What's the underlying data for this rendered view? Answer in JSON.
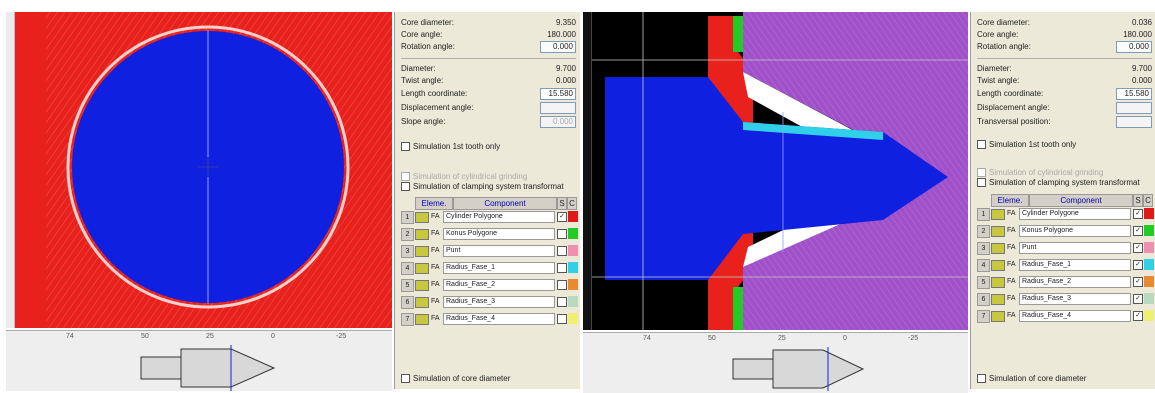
{
  "left_panel": {
    "params": [
      {
        "label": "Core diameter:",
        "value": "9.350"
      },
      {
        "label": "Core angle:",
        "value": "180.000"
      },
      {
        "label": "Rotation angle:",
        "value": "0.000",
        "input": true
      }
    ],
    "params2": [
      {
        "label": "Diameter:",
        "value": "9.700"
      },
      {
        "label": "Twist angle:",
        "value": "0.000"
      },
      {
        "label": "Length coordinate:",
        "value": "15.580",
        "input": true
      },
      {
        "label": "Displacement angle:",
        "value": "",
        "input": true,
        "disabled": true
      },
      {
        "label": "Slope angle:",
        "value": "0.000",
        "input": true,
        "disabled": true
      }
    ],
    "sim_first_tooth": "Simulation 1st tooth only",
    "sim_cylindrical": "Simulation of cylindrical grinding",
    "sim_clamping": "Simulation of clamping system transformat",
    "sim_core": "Simulation of core diameter",
    "grid": {
      "head_elem": "Eleme.",
      "head_comp": "Component",
      "head_s": "S",
      "head_c": "C",
      "rows": [
        {
          "num": "1",
          "fa": "FA",
          "name": "Cylinder Polygone",
          "checked": true,
          "color": "#e01818"
        },
        {
          "num": "2",
          "fa": "FA",
          "name": "Konus Polygone",
          "checked": false,
          "color": "#22cc22"
        },
        {
          "num": "3",
          "fa": "FA",
          "name": "Punt",
          "checked": false,
          "color": "#f090b0"
        },
        {
          "num": "4",
          "fa": "FA",
          "name": "Radius_Fase_1",
          "checked": false,
          "color": "#30d0e8"
        },
        {
          "num": "5",
          "fa": "FA",
          "name": "Radius_Fase_2",
          "checked": false,
          "color": "#e88a30"
        },
        {
          "num": "6",
          "fa": "FA",
          "name": "Radius_Fase_3",
          "checked": false,
          "color": "#b8d8c0"
        },
        {
          "num": "7",
          "fa": "FA",
          "name": "Radius_Fase_4",
          "checked": false,
          "color": "#f0f070"
        }
      ]
    },
    "x_ticks": [
      "74",
      "50",
      "25",
      "0",
      "-25"
    ]
  },
  "right_panel": {
    "params": [
      {
        "label": "Core diameter:",
        "value": "0.036"
      },
      {
        "label": "Core angle:",
        "value": "180.000"
      },
      {
        "label": "Rotation angle:",
        "value": "0.000",
        "input": true
      }
    ],
    "params2": [
      {
        "label": "Diameter:",
        "value": "9.700"
      },
      {
        "label": "Twist angle:",
        "value": "0.000"
      },
      {
        "label": "Length coordinate:",
        "value": "15.580",
        "input": true
      },
      {
        "label": "Displacement angle:",
        "value": "",
        "input": true,
        "disabled": true
      },
      {
        "label": "Transversal position:",
        "value": "",
        "input": true,
        "disabled": true
      }
    ],
    "sim_first_tooth": "Simulation 1st tooth only",
    "sim_cylindrical": "Simulation of cylindrical grinding",
    "sim_clamping": "Simulation of clamping system transformat",
    "sim_core": "Simulation of core diameter",
    "grid": {
      "head_elem": "Eleme.",
      "head_comp": "Component",
      "head_s": "S",
      "head_c": "C",
      "rows": [
        {
          "num": "1",
          "fa": "FA",
          "name": "Cylinder Polygone",
          "checked": true,
          "color": "#e01818"
        },
        {
          "num": "2",
          "fa": "FA",
          "name": "Konus Polygone",
          "checked": true,
          "color": "#22cc22"
        },
        {
          "num": "3",
          "fa": "FA",
          "name": "Punt",
          "checked": true,
          "color": "#f090b0"
        },
        {
          "num": "4",
          "fa": "FA",
          "name": "Radius_Fase_1",
          "checked": true,
          "color": "#30d0e8"
        },
        {
          "num": "5",
          "fa": "FA",
          "name": "Radius_Fase_2",
          "checked": true,
          "color": "#e88a30"
        },
        {
          "num": "6",
          "fa": "FA",
          "name": "Radius_Fase_3",
          "checked": true,
          "color": "#b8d8c0"
        },
        {
          "num": "7",
          "fa": "FA",
          "name": "Radius_Fase_4",
          "checked": true,
          "color": "#f0f070"
        }
      ]
    },
    "x_ticks": [
      "74",
      "50",
      "25",
      "0",
      "-25"
    ]
  },
  "colors": {
    "blue": "#1020e0",
    "red": "#e8211d",
    "purple": "#a050c8",
    "green": "#22cc22"
  }
}
